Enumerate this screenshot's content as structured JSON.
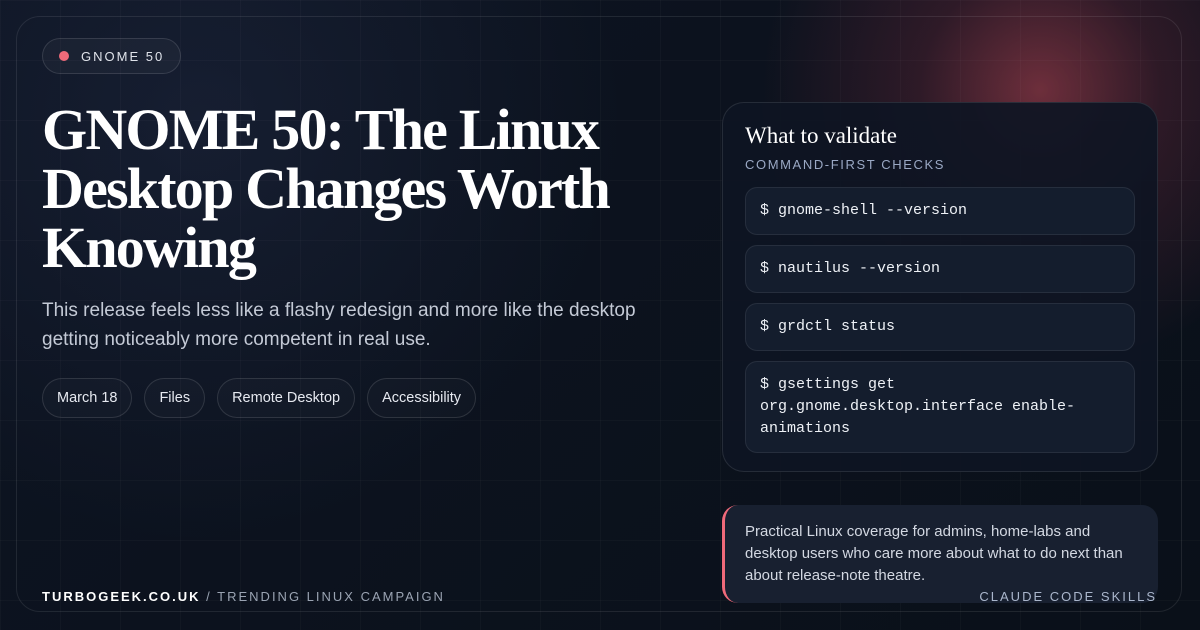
{
  "badge": {
    "label": "GNOME 50",
    "dot_color": "#f06a7a"
  },
  "headline": "GNOME 50: The Linux Desktop Changes Worth Knowing",
  "subtitle": "This release feels less like a flashy redesign and more like the desktop getting noticeably more competent in real use.",
  "tags": [
    "March 18",
    "Files",
    "Remote Desktop",
    "Accessibility"
  ],
  "validate_card": {
    "title": "What to validate",
    "subtitle": "COMMAND-FIRST CHECKS",
    "commands": [
      "$ gnome-shell --version",
      "$ nautilus --version",
      "$ grdctl status",
      "$ gsettings get org.gnome.desktop.interface enable-animations"
    ]
  },
  "note": "Practical Linux coverage for admins, home-labs and desktop users who care more about what to do next than about release-note theatre.",
  "footer": {
    "site": "TURBOGEEK.CO.UK",
    "separator": " / ",
    "campaign": "TRENDING LINUX CAMPAIGN",
    "right_label": "CLAUDE CODE SKILLS"
  },
  "colors": {
    "accent": "#f06a7a",
    "background": "#0b111d"
  }
}
